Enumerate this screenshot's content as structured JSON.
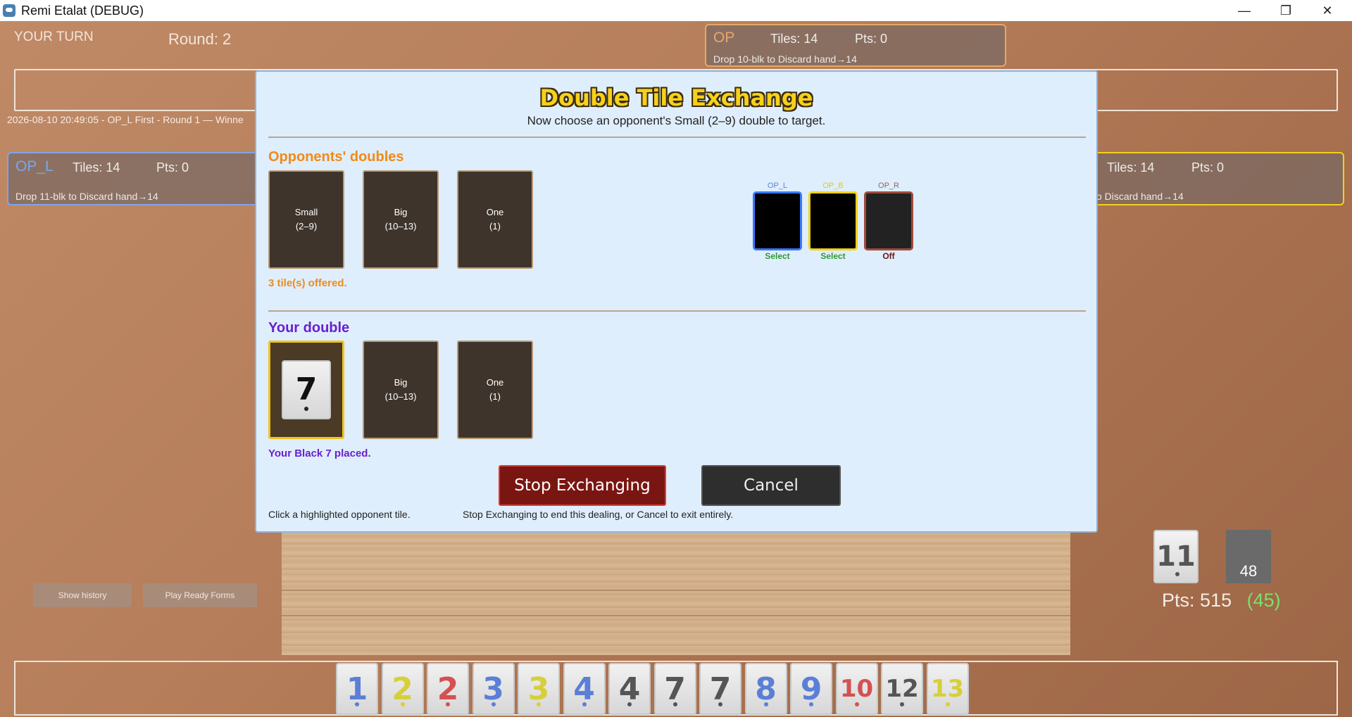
{
  "window": {
    "title": "Remi Etalat (DEBUG)",
    "min": "—",
    "max": "❐",
    "close": "✕"
  },
  "hud": {
    "turn": "YOUR TURN",
    "round": "Round: 2"
  },
  "log": "2026-08-10 20:49:05 - OP_L First - Round 1  —  Winne",
  "players": {
    "op": {
      "name": "OP",
      "tiles": "Tiles: 14",
      "pts": "Pts: 0",
      "msg": "Drop 10-blk to Discard  hand→14",
      "color": "#e8a765"
    },
    "op_l": {
      "name": "OP_L",
      "tiles": "Tiles: 14",
      "pts": "Pts: 0",
      "msg": "Drop 11-blk to Discard  hand→14",
      "color": "#7ea5e8"
    },
    "op_r": {
      "tiles": "Tiles: 14",
      "pts": "Pts: 0",
      "msg": "o Discard  hand→14"
    }
  },
  "buttons": {
    "history": "Show history",
    "ready": "Play Ready Forms"
  },
  "modal": {
    "title": "Double Tile Exchange",
    "subtitle": "Now choose an opponent's Small (2–9) double to target.",
    "opp_head": "Opponents' doubles",
    "opp_slots": [
      {
        "name": "Small",
        "range": "(2–9)"
      },
      {
        "name": "Big",
        "range": "(10–13)"
      },
      {
        "name": "One",
        "range": "(1)"
      }
    ],
    "opp_note": "3 tile(s) offered.",
    "chips": [
      {
        "label": "OP_L",
        "state": "Select",
        "border": "#3a78ff",
        "label_color": "#5b86d8",
        "state_color": "#2f9a33"
      },
      {
        "label": "OP_B",
        "state": "Select",
        "border": "#f2d21a",
        "label_color": "#e7c518",
        "state_color": "#2f9a33"
      },
      {
        "label": "OP_R",
        "state": "Off",
        "border": "#a14b3a",
        "label_color": "#8a6a60",
        "state_color": "#6a1a12"
      }
    ],
    "your_head": "Your double",
    "your_tile": "7",
    "your_slots": [
      {
        "name": "Big",
        "range": "(10–13)"
      },
      {
        "name": "One",
        "range": "(1)"
      }
    ],
    "your_note": "Your Black 7 placed.",
    "stop_label": "Stop Exchanging",
    "cancel_label": "Cancel",
    "hint_left": "Click a highlighted opponent tile.",
    "hint_right": "Stop Exchanging to end this dealing, or Cancel to exit entirely."
  },
  "pool": {
    "top_tile": "11",
    "deck_count": "48",
    "pts_label": "Pts:",
    "pts_value": "515",
    "pts_delta": "(45)"
  },
  "hand": [
    {
      "v": "1",
      "c": "#5b7fd6"
    },
    {
      "v": "2",
      "c": "#d6cf3a"
    },
    {
      "v": "2",
      "c": "#d45151"
    },
    {
      "v": "3",
      "c": "#5b7fd6"
    },
    {
      "v": "3",
      "c": "#d6cf3a"
    },
    {
      "v": "4",
      "c": "#5b7fd6"
    },
    {
      "v": "4",
      "c": "#555555"
    },
    {
      "v": "7",
      "c": "#555555"
    },
    {
      "v": "7",
      "c": "#555555"
    },
    {
      "v": "8",
      "c": "#5b7fd6"
    },
    {
      "v": "9",
      "c": "#5b7fd6"
    },
    {
      "v": "10",
      "c": "#d45151"
    },
    {
      "v": "12",
      "c": "#555555"
    },
    {
      "v": "13",
      "c": "#d6cf3a"
    }
  ]
}
